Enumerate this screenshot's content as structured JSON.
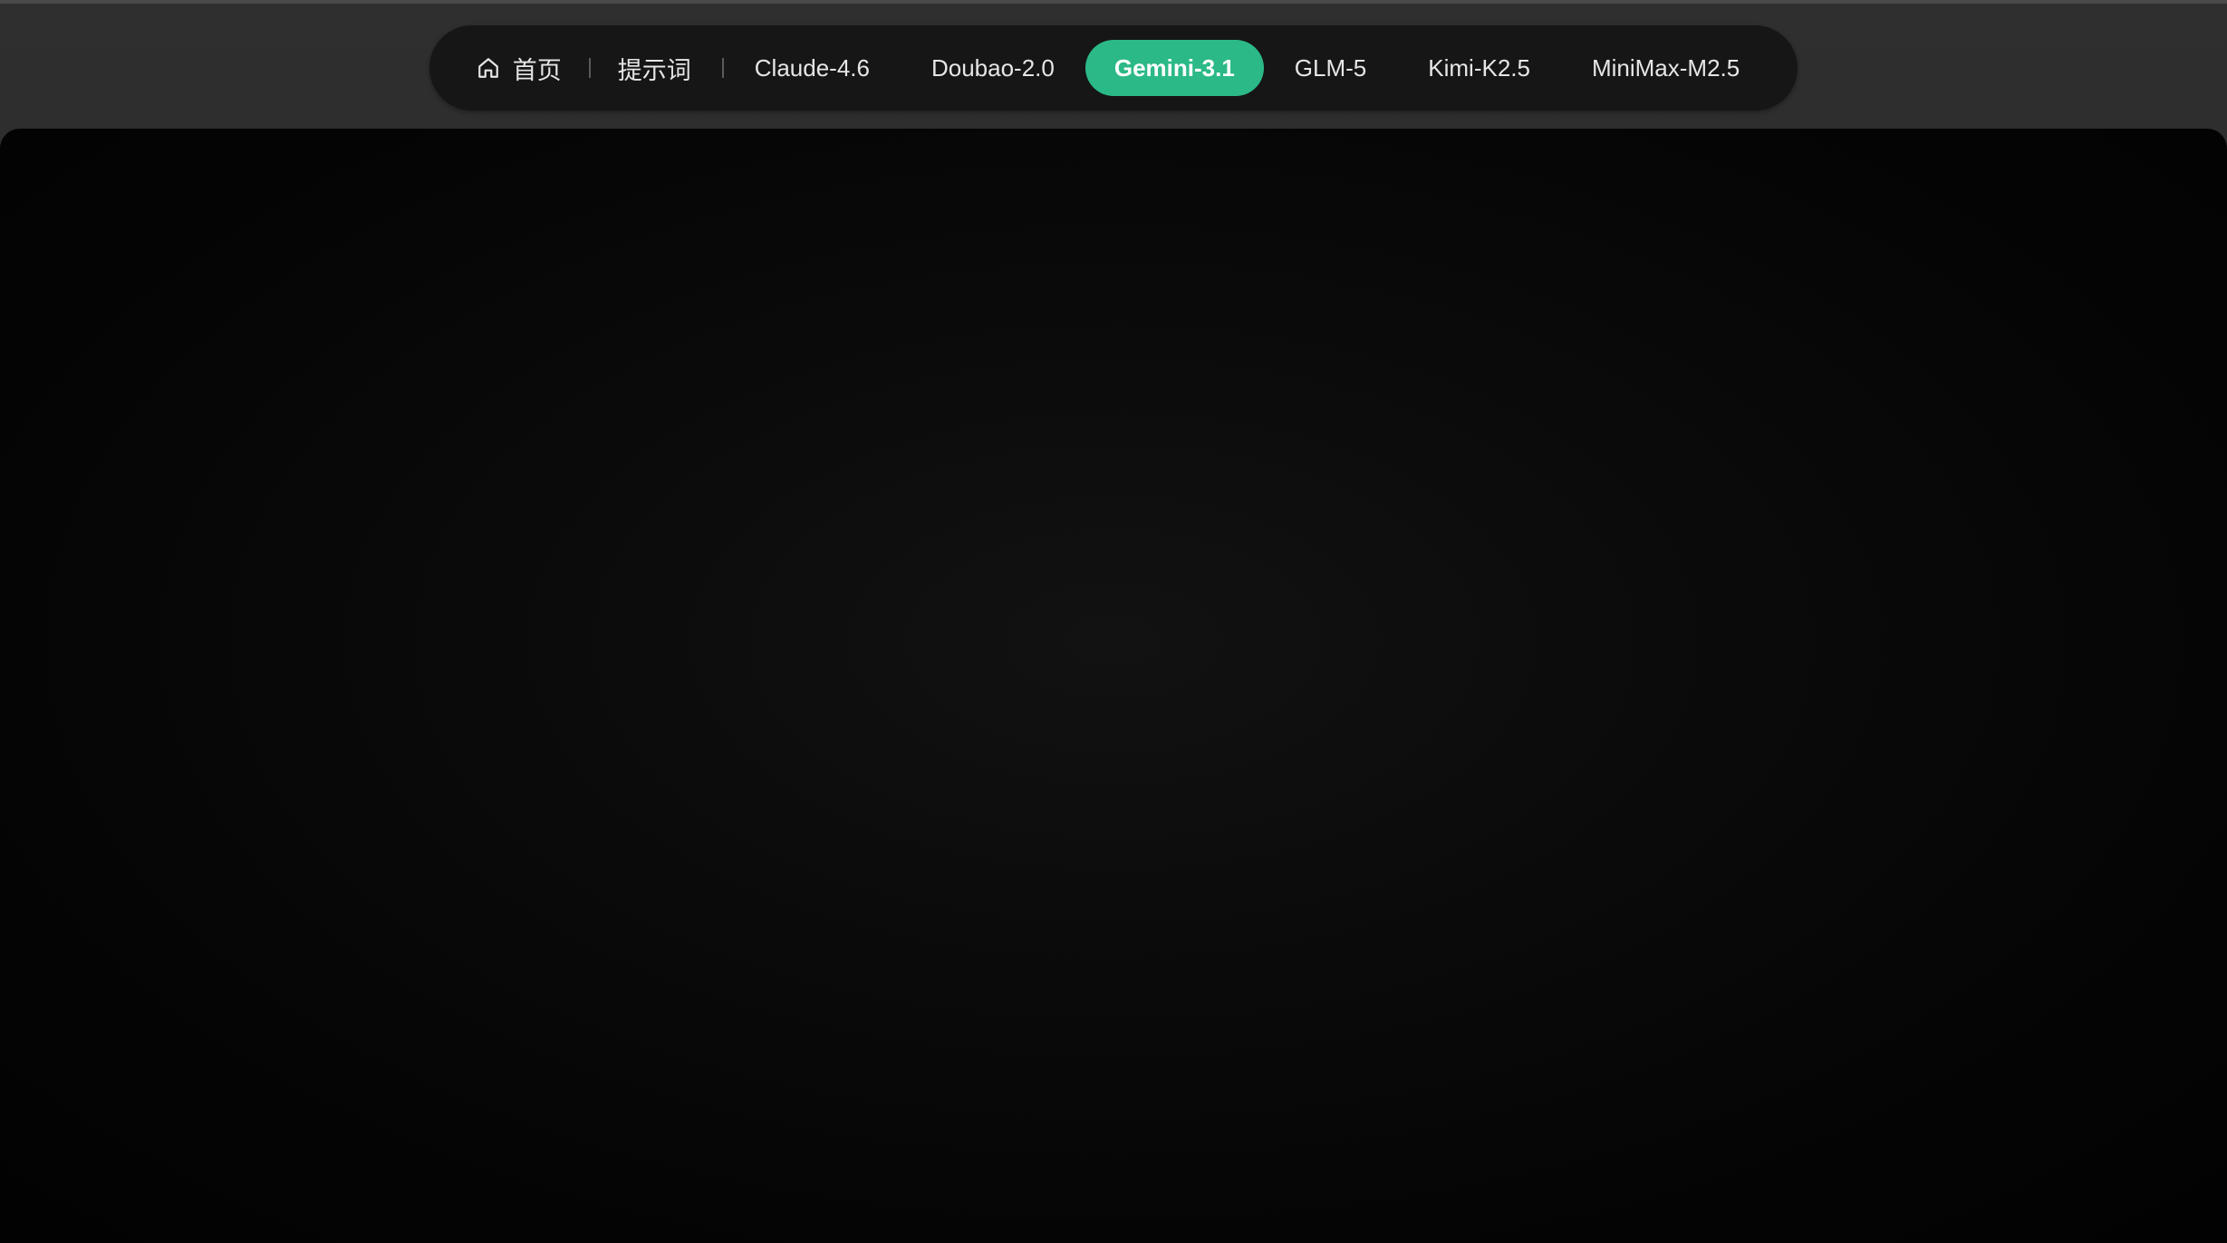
{
  "nav": {
    "home_label": "首页",
    "prompt_label": "提示词",
    "models": [
      {
        "label": "Claude-4.6"
      },
      {
        "label": "Doubao-2.0"
      },
      {
        "label": "Gemini-3.1"
      },
      {
        "label": "GLM-5"
      },
      {
        "label": "Kimi-K2.5"
      },
      {
        "label": "MiniMax-M2.5"
      }
    ],
    "active_model": "Gemini-3.1",
    "home_icon": "home-icon"
  },
  "colors": {
    "accent": "#2bb987",
    "nav_bg": "#161616",
    "page_bg": "#2e2e2e",
    "stage_bg": "#050505"
  }
}
